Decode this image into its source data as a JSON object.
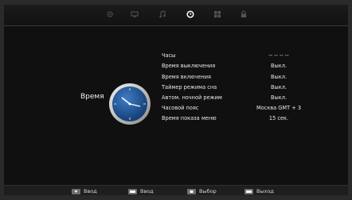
{
  "tabs": [
    {
      "icon": "gear-icon",
      "active": false
    },
    {
      "icon": "monitor-icon",
      "active": false
    },
    {
      "icon": "music-note-icon",
      "active": false
    },
    {
      "icon": "clock-icon",
      "active": true
    },
    {
      "icon": "grid-icon",
      "active": false
    },
    {
      "icon": "lock-icon",
      "active": false
    }
  ],
  "section": {
    "title": "Время",
    "icon": "clock-icon"
  },
  "menu": {
    "rows": [
      {
        "label": "Часы",
        "value": "-- --  -- --"
      },
      {
        "label": "Время выключения",
        "value": "Выкл."
      },
      {
        "label": "Время включения",
        "value": "Выкл."
      },
      {
        "label": "Таймер режима сна",
        "value": "Выкл."
      },
      {
        "label": "Автом. ночной режим",
        "value": "Выкл."
      },
      {
        "label": "Часовой пояс",
        "value": "Москва GMT + 3"
      },
      {
        "label": "Время показа меню",
        "value": "15 сек."
      }
    ]
  },
  "footer": {
    "hints": [
      {
        "key": "down-arrow-key-icon",
        "label": "Ввод"
      },
      {
        "key": "ok-key-icon",
        "label": "Ввод"
      },
      {
        "key": "left-right-key-icon",
        "label": "Выбор"
      },
      {
        "key": "exit-key-icon",
        "label": "Выход"
      }
    ]
  },
  "colors": {
    "background": "#101010",
    "clock_face": "#1f4f8f",
    "accent": "#ffffff"
  }
}
